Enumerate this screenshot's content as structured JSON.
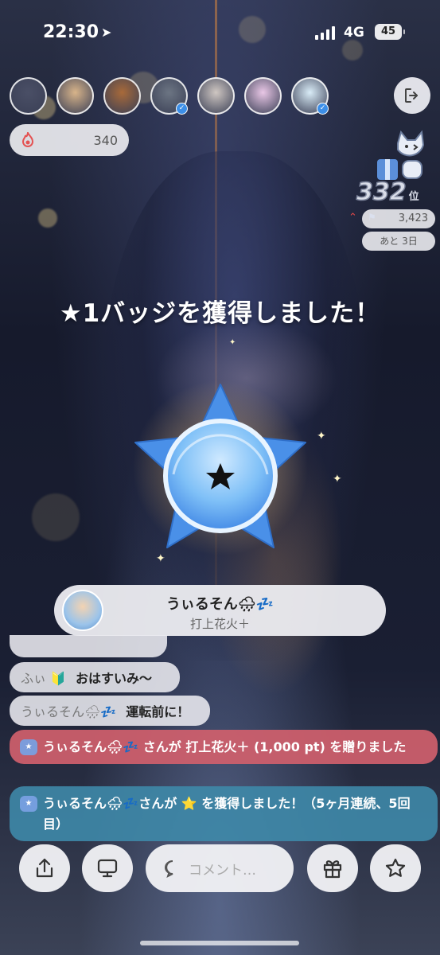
{
  "status_bar": {
    "time": "22:30",
    "network": "4G",
    "battery": "45"
  },
  "top_bar": {
    "viewer_avatars": [
      {
        "name": "viewer-avatar-1",
        "verified": false,
        "color": "#4a4f66"
      },
      {
        "name": "viewer-avatar-2",
        "verified": false,
        "color": "#d8b48a"
      },
      {
        "name": "viewer-avatar-3",
        "verified": false,
        "color": "#a86a3a"
      },
      {
        "name": "viewer-avatar-4",
        "verified": true,
        "color": "#6c7583"
      },
      {
        "name": "viewer-avatar-5",
        "verified": false,
        "color": "#cfc7c2"
      },
      {
        "name": "viewer-avatar-6",
        "verified": false,
        "color": "#e9c7e6"
      },
      {
        "name": "viewer-avatar-7",
        "verified": true,
        "color": "#d9ecf7"
      }
    ],
    "exit_icon": "exit-icon"
  },
  "score": {
    "value": "340",
    "icon": "flame-icon"
  },
  "ranking": {
    "rank": "332",
    "rank_unit": "位",
    "points": "3,423",
    "remaining": "あと 3日"
  },
  "badge_overlay": {
    "title": "★1バッジを獲得しました！"
  },
  "gift_card": {
    "sender": "うぃるそん🌧💤",
    "item": "打上花火＋"
  },
  "comments": [
    {
      "user": "ふぃ 🔰",
      "text": "おはすいみ〜"
    },
    {
      "user": "うぃるそん🌧💤",
      "text": "運転前に！"
    }
  ],
  "system_messages": [
    {
      "text": "うぃるそん🌧💤 さんが 打上花火＋ (1,000 pt) を贈りました"
    },
    {
      "text": "うぃるそん🌧💤さんが ⭐ を獲得しました！（5ヶ月連続、5回目）"
    }
  ],
  "bottom_bar": {
    "comment_placeholder": "コメント…",
    "share_icon": "share-icon",
    "screen_icon": "screen-icon",
    "gift_icon": "gift-icon",
    "favorite_icon": "star-icon"
  },
  "colors": {
    "badge_blue": "#4a90e8",
    "gift_message_bg": "#d05f6c",
    "badge_message_bg": "#3e88a8"
  }
}
